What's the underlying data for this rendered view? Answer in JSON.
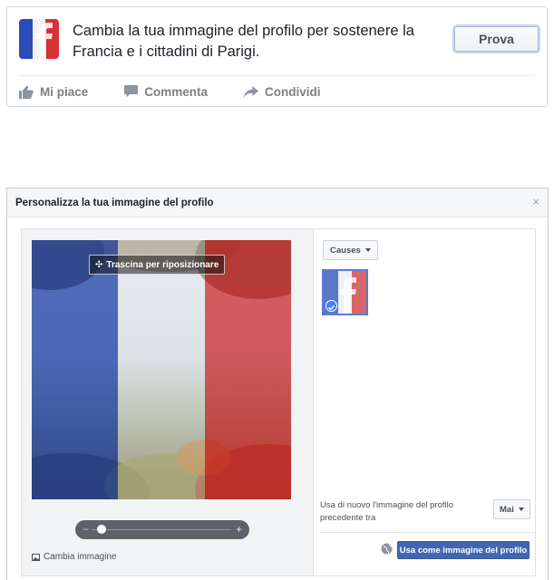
{
  "post": {
    "icon": "france-flag-facebook-icon",
    "text": "Cambia la tua immagine del profilo per sostenere la Francia e i cittadini di Parigi.",
    "try_button": "Prova",
    "actions": [
      {
        "label": "Mi piace",
        "icon": "thumbs-up-icon"
      },
      {
        "label": "Commenta",
        "icon": "comment-icon"
      },
      {
        "label": "Condividi",
        "icon": "share-icon"
      }
    ]
  },
  "dialog": {
    "title": "Personalizza la tua immagine del profilo",
    "close": "×",
    "drag_label": "Trascina per riposizionare",
    "zoom_level": 0.05,
    "change_image": "Cambia immagine",
    "causes_button": "Causes",
    "reuse_text": "Usa di nuovo l'immagine del profilo precedente tra",
    "reuse_select": "Mai",
    "use_button": "Usa come immagine del profilo"
  },
  "colors": {
    "flag_blue": "#1a3ea8",
    "flag_white": "#f2f2f2",
    "flag_red": "#d0292c",
    "facebook_blue": "#4267b2",
    "link_blue": "#4080ff"
  }
}
